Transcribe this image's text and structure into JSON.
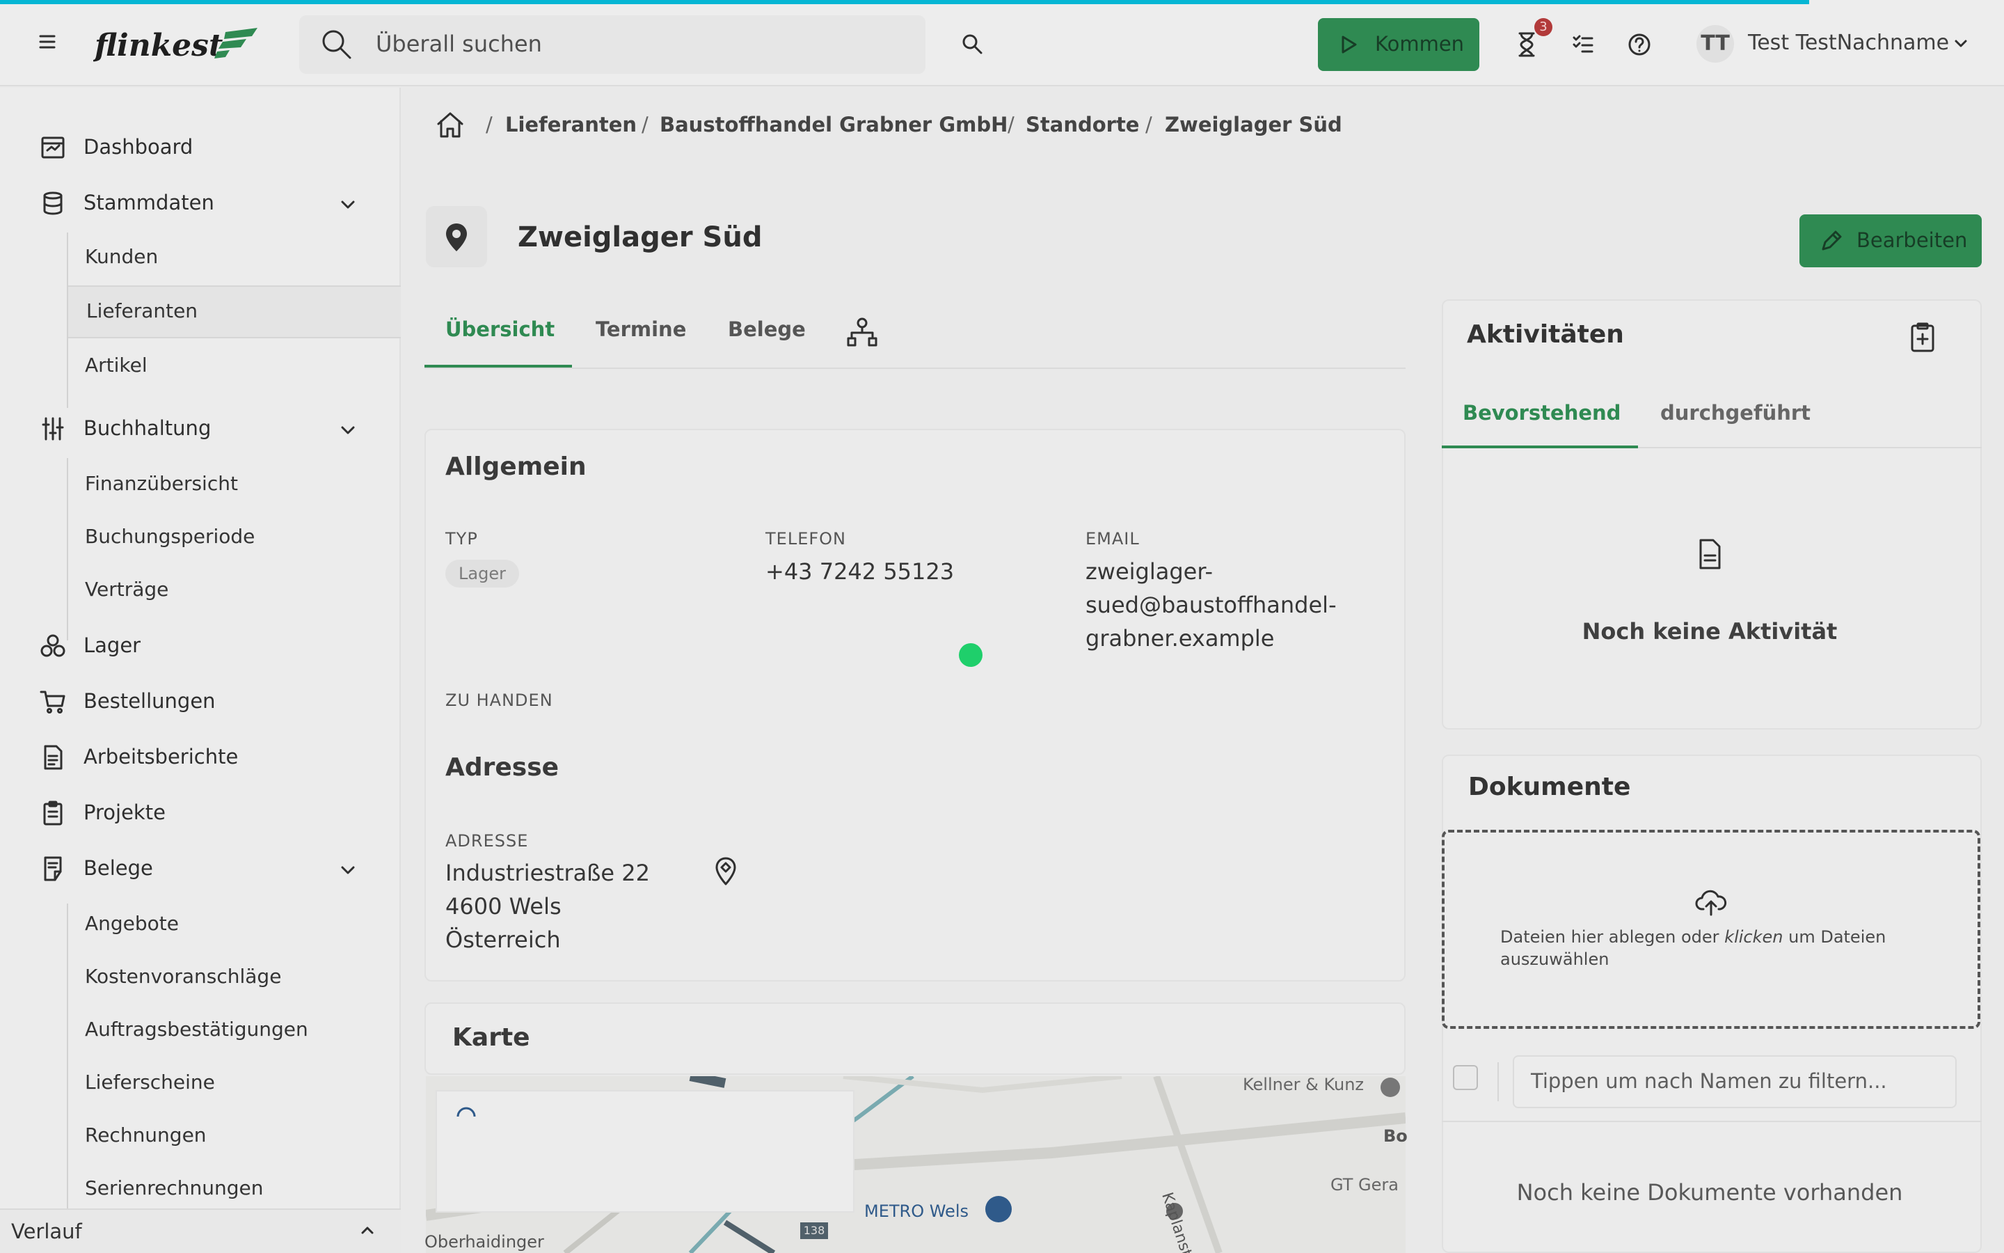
{
  "header": {
    "logo": "flinkest",
    "search_placeholder": "Überall suchen",
    "kommen_label": "Kommen",
    "notification_count": "3",
    "avatar_initials": "TT",
    "user_name": "Test TestNachname"
  },
  "sidebar": {
    "items": [
      {
        "label": "Dashboard"
      },
      {
        "label": "Stammdaten"
      },
      {
        "label": "Kunden"
      },
      {
        "label": "Lieferanten"
      },
      {
        "label": "Artikel"
      },
      {
        "label": "Buchhaltung"
      },
      {
        "label": "Finanzübersicht"
      },
      {
        "label": "Buchungsperiode"
      },
      {
        "label": "Verträge"
      },
      {
        "label": "Lager"
      },
      {
        "label": "Bestellungen"
      },
      {
        "label": "Arbeitsberichte"
      },
      {
        "label": "Projekte"
      },
      {
        "label": "Belege"
      },
      {
        "label": "Angebote"
      },
      {
        "label": "Kostenvoranschläge"
      },
      {
        "label": "Auftragsbestätigungen"
      },
      {
        "label": "Lieferscheine"
      },
      {
        "label": "Rechnungen"
      },
      {
        "label": "Serienrechnungen"
      }
    ],
    "verlauf_label": "Verlauf"
  },
  "breadcrumb": [
    "Lieferanten",
    "Baustoffhandel Grabner GmbH",
    "Standorte",
    "Zweiglager Süd"
  ],
  "page": {
    "title": "Zweiglager Süd",
    "edit_label": "Bearbeiten",
    "tabs": [
      "Übersicht",
      "Termine",
      "Belege"
    ]
  },
  "allgemein": {
    "title": "Allgemein",
    "typ_label": "TYP",
    "typ_value": "Lager",
    "telefon_label": "TELEFON",
    "telefon_value": "+43 7242 55123",
    "email_label": "EMAIL",
    "email_lines": [
      "zweiglager-",
      "sued@baustoffhandel-",
      "grabner.example"
    ],
    "zu_handen_label": "ZU HANDEN"
  },
  "adresse": {
    "title": "Adresse",
    "label": "ADRESSE",
    "lines": [
      "Industriestraße 22",
      "4600 Wels",
      "Österreich"
    ]
  },
  "karte": {
    "title": "Karte",
    "labels": [
      "Kellner & Kunz",
      "Bo",
      "GT Gera",
      "METRO Wels",
      "Kaplanstraß",
      "Oberhaidinger",
      "138"
    ]
  },
  "aktivitaeten": {
    "title": "Aktivitäten",
    "tabs": [
      "Bevorstehend",
      "durchgeführt"
    ],
    "empty": "Noch keine Aktivität"
  },
  "dokumente": {
    "title": "Dokumente",
    "drop_pre": "Dateien hier ablegen oder ",
    "drop_em": "klicken",
    "drop_post": " um Dateien",
    "drop_line2": "auszuwählen",
    "filter_placeholder": "Tippen um nach Namen zu filtern...",
    "empty": "Noch keine Dokumente vorhanden"
  },
  "colors": {
    "accent": "#2f8a52",
    "progress": "#06b6d4",
    "badge": "#b23a3a"
  }
}
